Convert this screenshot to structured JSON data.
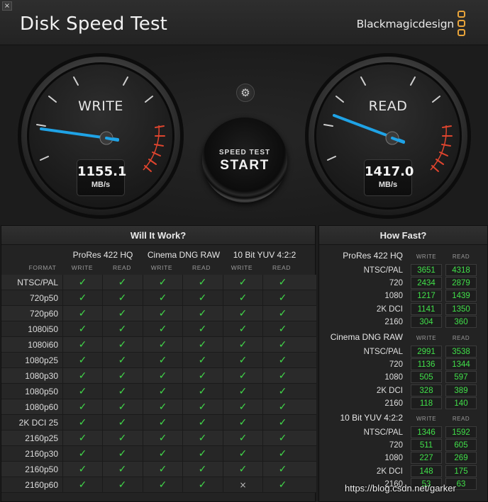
{
  "window": {
    "close_glyph": "×",
    "title": "Disk Speed Test",
    "brand": "Blackmagicdesign"
  },
  "gauges": {
    "write": {
      "label": "WRITE",
      "value": "1155.1",
      "unit": "MB/s"
    },
    "read": {
      "label": "READ",
      "value": "1417.0",
      "unit": "MB/s"
    }
  },
  "controls": {
    "settings_icon": "gear-icon",
    "start_line1": "SPEED TEST",
    "start_line2": "START"
  },
  "will_it_work": {
    "title": "Will It Work?",
    "groups": [
      "ProRes 422 HQ",
      "Cinema DNG RAW",
      "10 Bit YUV 4:2:2"
    ],
    "format_label": "FORMAT",
    "write_label": "WRITE",
    "read_label": "READ",
    "rows": [
      {
        "format": "NTSC/PAL",
        "cells": [
          "✓",
          "✓",
          "✓",
          "✓",
          "✓",
          "✓"
        ]
      },
      {
        "format": "720p50",
        "cells": [
          "✓",
          "✓",
          "✓",
          "✓",
          "✓",
          "✓"
        ]
      },
      {
        "format": "720p60",
        "cells": [
          "✓",
          "✓",
          "✓",
          "✓",
          "✓",
          "✓"
        ]
      },
      {
        "format": "1080i50",
        "cells": [
          "✓",
          "✓",
          "✓",
          "✓",
          "✓",
          "✓"
        ]
      },
      {
        "format": "1080i60",
        "cells": [
          "✓",
          "✓",
          "✓",
          "✓",
          "✓",
          "✓"
        ]
      },
      {
        "format": "1080p25",
        "cells": [
          "✓",
          "✓",
          "✓",
          "✓",
          "✓",
          "✓"
        ]
      },
      {
        "format": "1080p30",
        "cells": [
          "✓",
          "✓",
          "✓",
          "✓",
          "✓",
          "✓"
        ]
      },
      {
        "format": "1080p50",
        "cells": [
          "✓",
          "✓",
          "✓",
          "✓",
          "✓",
          "✓"
        ]
      },
      {
        "format": "1080p60",
        "cells": [
          "✓",
          "✓",
          "✓",
          "✓",
          "✓",
          "✓"
        ]
      },
      {
        "format": "2K DCI 25",
        "cells": [
          "✓",
          "✓",
          "✓",
          "✓",
          "✓",
          "✓"
        ]
      },
      {
        "format": "2160p25",
        "cells": [
          "✓",
          "✓",
          "✓",
          "✓",
          "✓",
          "✓"
        ]
      },
      {
        "format": "2160p30",
        "cells": [
          "✓",
          "✓",
          "✓",
          "✓",
          "✓",
          "✓"
        ]
      },
      {
        "format": "2160p50",
        "cells": [
          "✓",
          "✓",
          "✓",
          "✓",
          "✓",
          "✓"
        ]
      },
      {
        "format": "2160p60",
        "cells": [
          "✓",
          "✓",
          "✓",
          "✓",
          "×",
          "✓"
        ]
      }
    ]
  },
  "how_fast": {
    "title": "How Fast?",
    "write_label": "WRITE",
    "read_label": "READ",
    "groups": [
      {
        "name": "ProRes 422 HQ",
        "rows": [
          {
            "res": "NTSC/PAL",
            "write": "3651",
            "read": "4318"
          },
          {
            "res": "720",
            "write": "2434",
            "read": "2879"
          },
          {
            "res": "1080",
            "write": "1217",
            "read": "1439"
          },
          {
            "res": "2K DCI",
            "write": "1141",
            "read": "1350"
          },
          {
            "res": "2160",
            "write": "304",
            "read": "360"
          }
        ]
      },
      {
        "name": "Cinema DNG RAW",
        "rows": [
          {
            "res": "NTSC/PAL",
            "write": "2991",
            "read": "3538"
          },
          {
            "res": "720",
            "write": "1136",
            "read": "1344"
          },
          {
            "res": "1080",
            "write": "505",
            "read": "597"
          },
          {
            "res": "2K DCI",
            "write": "328",
            "read": "389"
          },
          {
            "res": "2160",
            "write": "118",
            "read": "140"
          }
        ]
      },
      {
        "name": "10 Bit YUV 4:2:2",
        "rows": [
          {
            "res": "NTSC/PAL",
            "write": "1346",
            "read": "1592"
          },
          {
            "res": "720",
            "write": "511",
            "read": "605"
          },
          {
            "res": "1080",
            "write": "227",
            "read": "269"
          },
          {
            "res": "2K DCI",
            "write": "148",
            "read": "175"
          },
          {
            "res": "2160",
            "write": "53",
            "read": "63"
          }
        ]
      }
    ]
  },
  "watermark": "https://blog.csdn.net/garker",
  "colors": {
    "accent_green": "#41d94a",
    "needle_blue": "#1fa3e6",
    "redline": "#e0452e",
    "brand_orange": "#e9a43a"
  }
}
